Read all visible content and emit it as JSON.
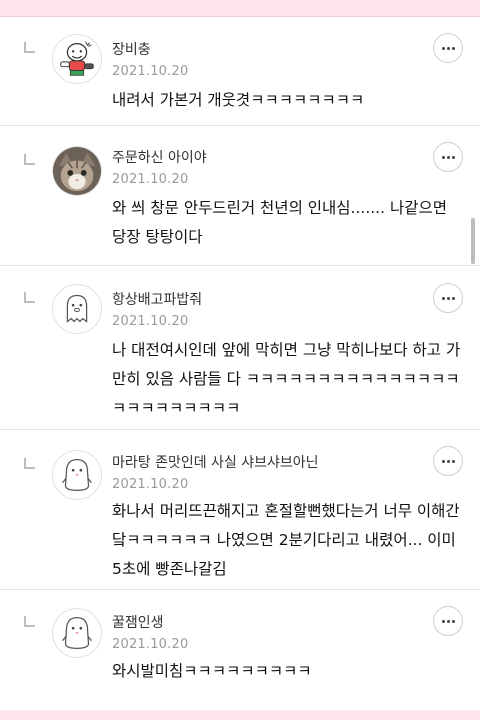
{
  "comments": [
    {
      "nickname": "장비충",
      "date": "2021.10.20",
      "text": "내려서 가본거 개웃겻ㅋㅋㅋㅋㅋㅋㅋㅋ",
      "avatar": "cartoon-character-avatar"
    },
    {
      "nickname": "주문하신 아이야",
      "date": "2021.10.20",
      "text": "와 씌 창문 안두드린거 천년의 인내심....... 나같으면 당장 탕탕이다",
      "avatar": "cat-photo-avatar"
    },
    {
      "nickname": "항상배고파밥줘",
      "date": "2021.10.20",
      "text": "나 대전여시인데 앞에 막히면 그냥 막히나보다 하고 가만히 있음 사람들 다 ㅋㅋㅋㅋㅋㅋㅋㅋㅋㅋㅋㅋㅋㅋㅋㅋㅋㅋㅋㅋㅋㅋㅋㅋ",
      "avatar": "default-ghost-avatar"
    },
    {
      "nickname": "마라탕 존맛인데 사실 샤브샤브아닌",
      "date": "2021.10.20",
      "text": "화나서 머리뜨끈해지고 혼절할뻔했다는거 너무 이해간닼ㅋㅋㅋㅋㅋㅋ 나였으면 2분기다리고 내렸어... 이미 5초에 빵존나갈김",
      "avatar": "default-penguin-avatar"
    },
    {
      "nickname": "꿀잼인생",
      "date": "2021.10.20",
      "text": "와시발미침ㅋㅋㅋㅋㅋㅋㅋㅋㅋ",
      "avatar": "default-penguin-avatar"
    }
  ],
  "colors": {
    "accent_bar": "#fde3ec",
    "date_text": "#9a9a9a"
  }
}
